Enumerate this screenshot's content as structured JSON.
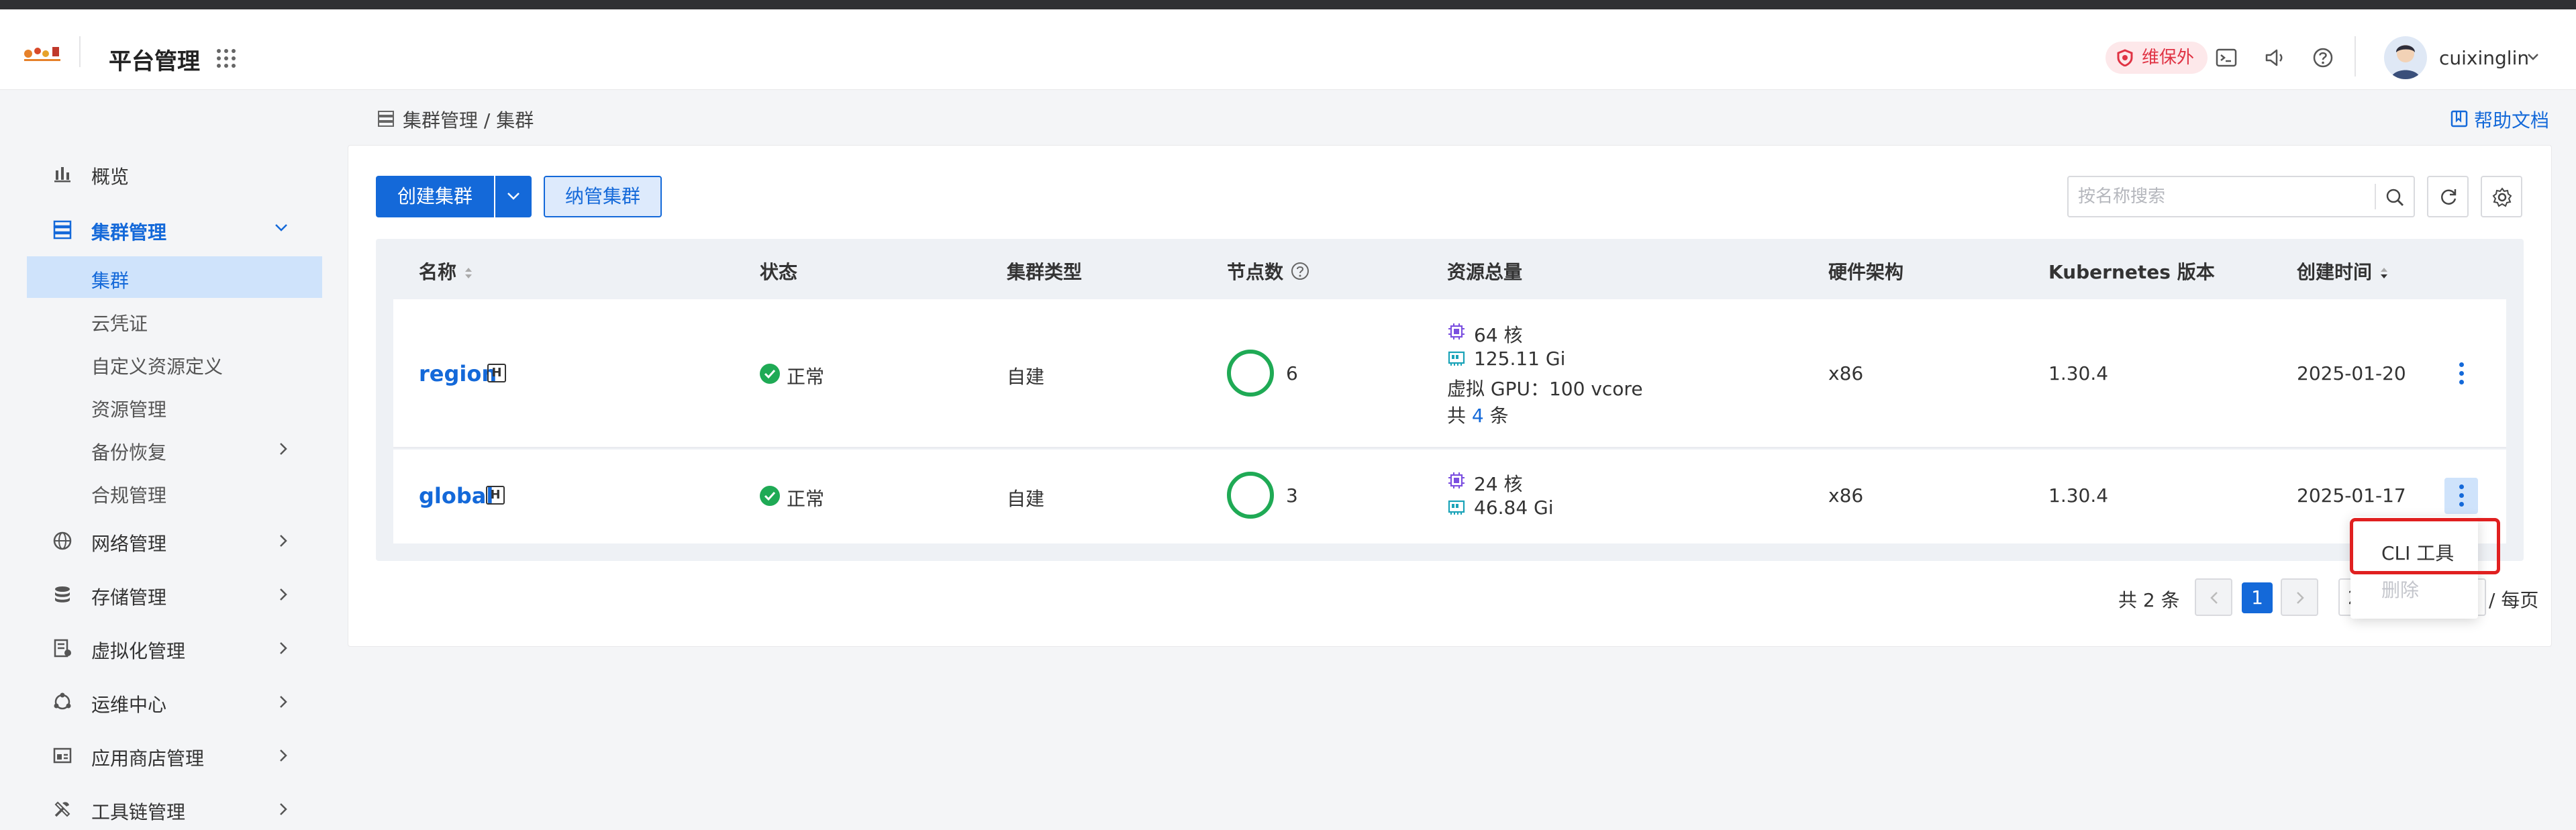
{
  "header": {
    "app_title": "平台管理",
    "badge": "维保外",
    "username": "cuixinglin"
  },
  "sidebar": {
    "items": [
      {
        "label": "概览"
      },
      {
        "label": "集群管理"
      },
      {
        "label": "网络管理"
      },
      {
        "label": "存储管理"
      },
      {
        "label": "虚拟化管理"
      },
      {
        "label": "运维中心"
      },
      {
        "label": "应用商店管理"
      },
      {
        "label": "工具链管理"
      }
    ],
    "sub_items": [
      {
        "label": "集群"
      },
      {
        "label": "云凭证"
      },
      {
        "label": "自定义资源定义"
      },
      {
        "label": "资源管理"
      },
      {
        "label": "备份恢复"
      },
      {
        "label": "合规管理"
      }
    ]
  },
  "breadcrumb": "集群管理 / 集群",
  "help_link": "帮助文档",
  "toolbar": {
    "create_label": "创建集群",
    "manage_label": "纳管集群",
    "search_placeholder": "按名称搜索"
  },
  "table": {
    "columns": [
      "名称",
      "状态",
      "集群类型",
      "节点数",
      "资源总量",
      "硬件架构",
      "Kubernetes 版本",
      "创建时间"
    ],
    "rows": [
      {
        "name": "region",
        "host_badge": "H",
        "status": "正常",
        "type": "自建",
        "nodes": "6",
        "res_cpu": "64 核",
        "res_mem": "125.11 Gi",
        "res_gpu": "虚拟 GPU：100 vcore",
        "res_total_prefix": "共",
        "res_total_count": "4",
        "res_total_suffix": "条",
        "arch": "x86",
        "k8s": "1.30.4",
        "created": "2025-01-20"
      },
      {
        "name": "global",
        "host_badge": "H",
        "status": "正常",
        "type": "自建",
        "nodes": "3",
        "res_cpu": "24 核",
        "res_mem": "46.84 Gi",
        "arch": "x86",
        "k8s": "1.30.4",
        "created": "2025-01-17"
      }
    ]
  },
  "pagination": {
    "total": "共 2 条",
    "page": "1",
    "page_size_fragment": "2",
    "per_page": "/ 每页"
  },
  "context_menu": {
    "cli": "CLI 工具",
    "delete": "删除"
  },
  "colors": {
    "primary": "#1469d9",
    "success": "#1faa55",
    "danger": "#e02020",
    "badge_text": "#e03344"
  }
}
